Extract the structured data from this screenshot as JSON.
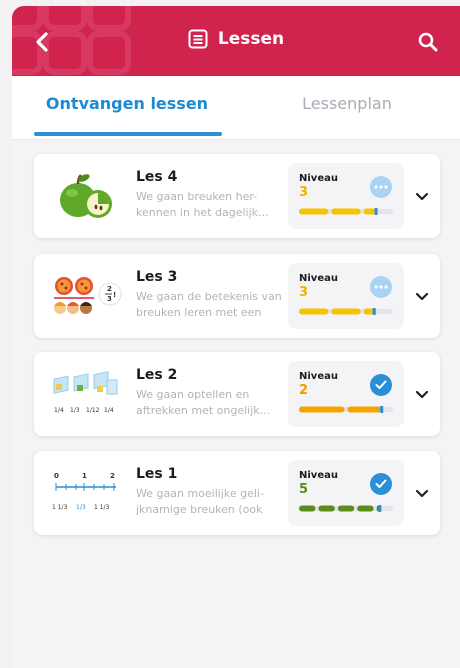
{
  "header": {
    "title": "Lessen",
    "color": "#d0234d"
  },
  "tabs": {
    "received": "Ontvangen lessen",
    "plan": "Lessenplan"
  },
  "lessons": [
    {
      "title": "Les 4",
      "description": "We gaan breuken her- kennen in het dagelijk...",
      "level_label": "Niveau",
      "level": "3",
      "status": "in-progress",
      "progress": 0.82,
      "color": "#f3c400",
      "num_color": "#f0b300",
      "illustration": "apple-icon"
    },
    {
      "title": "Les 3",
      "description": "We gaan de betekenis van breuken leren met een",
      "level_label": "Niveau",
      "level": "3",
      "status": "in-progress",
      "progress": 0.8,
      "color": "#f3c400",
      "num_color": "#f0b300",
      "illustration": "pizza-fraction-icon",
      "illustration_text": "2/3"
    },
    {
      "title": "Les 2",
      "description": "We gaan optellen en aftrekken met ongelijk...",
      "level_label": "Niveau",
      "level": "2",
      "status": "completed",
      "progress": 0.88,
      "color": "#f5a300",
      "num_color": "#f59a00",
      "illustration": "fraction-squares-icon",
      "illustration_text": [
        "1/4",
        "1/3",
        "1/12",
        "1/4"
      ]
    },
    {
      "title": "Les 1",
      "description": "We gaan moeilijke geli- jknamige breuken (ook gr...",
      "level_label": "Niveau",
      "level": "5",
      "status": "completed",
      "progress": 0.86,
      "color": "#5e8c1c",
      "num_color": "#5e8c1c",
      "illustration": "number-line-icon",
      "illustration_text": [
        "0",
        "1",
        "2",
        "1 1/3",
        "1/3",
        "1 1/3"
      ]
    }
  ]
}
